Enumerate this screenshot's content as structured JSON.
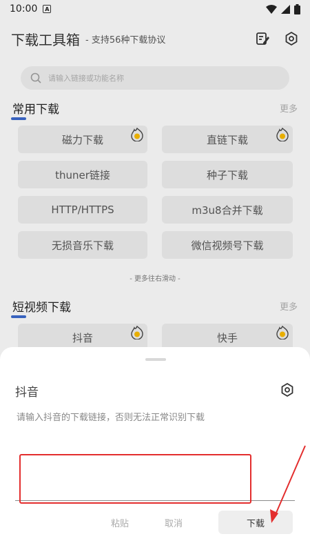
{
  "status_bar": {
    "time": "10:00",
    "badge": "A"
  },
  "header": {
    "title": "下载工具箱",
    "subtitle": "- 支持56种下载协议",
    "icons": [
      "notes-edit-icon",
      "settings-gear-icon"
    ]
  },
  "search": {
    "placeholder": "请输入链接或功能名称",
    "icon": "search-icon"
  },
  "sections": [
    {
      "title": "常用下载",
      "more": "更多",
      "tiles": [
        {
          "label": "磁力下载",
          "badge": true
        },
        {
          "label": "直链下载",
          "badge": true
        },
        {
          "label": "thuner链接",
          "badge": false
        },
        {
          "label": "种子下载",
          "badge": false
        },
        {
          "label": "HTTP/HTTPS",
          "badge": false
        },
        {
          "label": "m3u8合并下载",
          "badge": false
        },
        {
          "label": "无损音乐下载",
          "badge": false
        },
        {
          "label": "微信视频号下载",
          "badge": false
        }
      ],
      "hint": "- 更多往右滑动 -"
    },
    {
      "title": "短视频下载",
      "more": "更多",
      "tiles": [
        {
          "label": "抖音",
          "badge": true
        },
        {
          "label": "快手",
          "badge": true
        }
      ]
    }
  ],
  "sheet": {
    "title": "抖音",
    "instruction": "请输入抖音的下载链接，否则无法正常识别下载",
    "input_value": "",
    "paste_label": "粘贴",
    "cancel_label": "取消",
    "download_label": "下载"
  },
  "colors": {
    "accent_bar": "#3a66c5",
    "annotation_red": "#e32d2d",
    "badge_yellow": "#f0b400"
  }
}
